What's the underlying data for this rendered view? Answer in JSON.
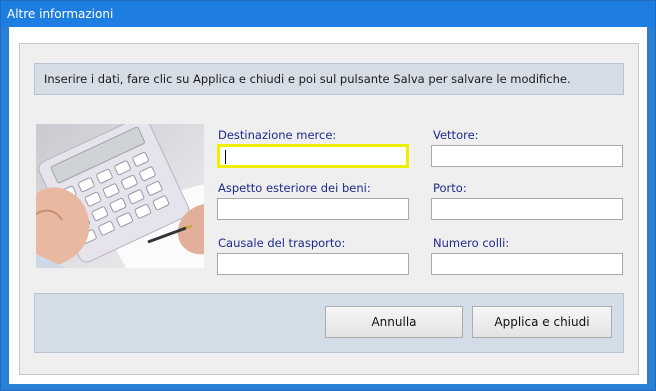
{
  "window": {
    "title": "Altre informazioni"
  },
  "info_text": "Inserire i dati, fare clic su Applica e chiudi e poi sul pulsante Salva per salvare le modifiche.",
  "fields": {
    "destinazione": {
      "label": "Destinazione merce:",
      "value": ""
    },
    "vettore": {
      "label": "Vettore:",
      "value": ""
    },
    "aspetto": {
      "label": "Aspetto esteriore dei beni:",
      "value": ""
    },
    "porto": {
      "label": "Porto:",
      "value": ""
    },
    "causale": {
      "label": "Causale del trasporto:",
      "value": ""
    },
    "colli": {
      "label": "Numero colli:",
      "value": ""
    }
  },
  "buttons": {
    "cancel": "Annulla",
    "apply": "Applica e chiudi"
  },
  "colors": {
    "titlebar": "#1e7de0",
    "label": "#1f2a8a",
    "focus": "#eef000"
  }
}
